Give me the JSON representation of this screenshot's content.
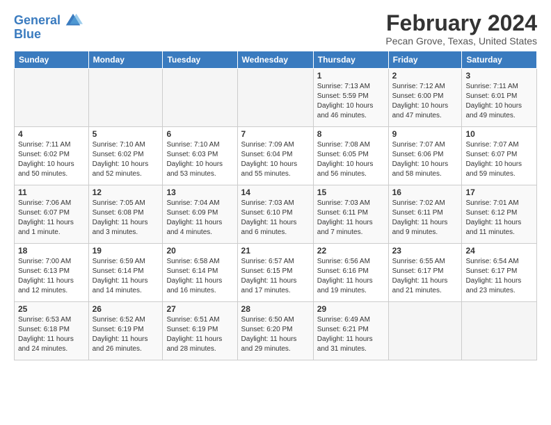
{
  "header": {
    "logo_line1": "General",
    "logo_line2": "Blue",
    "title": "February 2024",
    "subtitle": "Pecan Grove, Texas, United States"
  },
  "days_of_week": [
    "Sunday",
    "Monday",
    "Tuesday",
    "Wednesday",
    "Thursday",
    "Friday",
    "Saturday"
  ],
  "weeks": [
    [
      {
        "day": "",
        "info": ""
      },
      {
        "day": "",
        "info": ""
      },
      {
        "day": "",
        "info": ""
      },
      {
        "day": "",
        "info": ""
      },
      {
        "day": "1",
        "info": "Sunrise: 7:13 AM\nSunset: 5:59 PM\nDaylight: 10 hours\nand 46 minutes."
      },
      {
        "day": "2",
        "info": "Sunrise: 7:12 AM\nSunset: 6:00 PM\nDaylight: 10 hours\nand 47 minutes."
      },
      {
        "day": "3",
        "info": "Sunrise: 7:11 AM\nSunset: 6:01 PM\nDaylight: 10 hours\nand 49 minutes."
      }
    ],
    [
      {
        "day": "4",
        "info": "Sunrise: 7:11 AM\nSunset: 6:02 PM\nDaylight: 10 hours\nand 50 minutes."
      },
      {
        "day": "5",
        "info": "Sunrise: 7:10 AM\nSunset: 6:02 PM\nDaylight: 10 hours\nand 52 minutes."
      },
      {
        "day": "6",
        "info": "Sunrise: 7:10 AM\nSunset: 6:03 PM\nDaylight: 10 hours\nand 53 minutes."
      },
      {
        "day": "7",
        "info": "Sunrise: 7:09 AM\nSunset: 6:04 PM\nDaylight: 10 hours\nand 55 minutes."
      },
      {
        "day": "8",
        "info": "Sunrise: 7:08 AM\nSunset: 6:05 PM\nDaylight: 10 hours\nand 56 minutes."
      },
      {
        "day": "9",
        "info": "Sunrise: 7:07 AM\nSunset: 6:06 PM\nDaylight: 10 hours\nand 58 minutes."
      },
      {
        "day": "10",
        "info": "Sunrise: 7:07 AM\nSunset: 6:07 PM\nDaylight: 10 hours\nand 59 minutes."
      }
    ],
    [
      {
        "day": "11",
        "info": "Sunrise: 7:06 AM\nSunset: 6:07 PM\nDaylight: 11 hours\nand 1 minute."
      },
      {
        "day": "12",
        "info": "Sunrise: 7:05 AM\nSunset: 6:08 PM\nDaylight: 11 hours\nand 3 minutes."
      },
      {
        "day": "13",
        "info": "Sunrise: 7:04 AM\nSunset: 6:09 PM\nDaylight: 11 hours\nand 4 minutes."
      },
      {
        "day": "14",
        "info": "Sunrise: 7:03 AM\nSunset: 6:10 PM\nDaylight: 11 hours\nand 6 minutes."
      },
      {
        "day": "15",
        "info": "Sunrise: 7:03 AM\nSunset: 6:11 PM\nDaylight: 11 hours\nand 7 minutes."
      },
      {
        "day": "16",
        "info": "Sunrise: 7:02 AM\nSunset: 6:11 PM\nDaylight: 11 hours\nand 9 minutes."
      },
      {
        "day": "17",
        "info": "Sunrise: 7:01 AM\nSunset: 6:12 PM\nDaylight: 11 hours\nand 11 minutes."
      }
    ],
    [
      {
        "day": "18",
        "info": "Sunrise: 7:00 AM\nSunset: 6:13 PM\nDaylight: 11 hours\nand 12 minutes."
      },
      {
        "day": "19",
        "info": "Sunrise: 6:59 AM\nSunset: 6:14 PM\nDaylight: 11 hours\nand 14 minutes."
      },
      {
        "day": "20",
        "info": "Sunrise: 6:58 AM\nSunset: 6:14 PM\nDaylight: 11 hours\nand 16 minutes."
      },
      {
        "day": "21",
        "info": "Sunrise: 6:57 AM\nSunset: 6:15 PM\nDaylight: 11 hours\nand 17 minutes."
      },
      {
        "day": "22",
        "info": "Sunrise: 6:56 AM\nSunset: 6:16 PM\nDaylight: 11 hours\nand 19 minutes."
      },
      {
        "day": "23",
        "info": "Sunrise: 6:55 AM\nSunset: 6:17 PM\nDaylight: 11 hours\nand 21 minutes."
      },
      {
        "day": "24",
        "info": "Sunrise: 6:54 AM\nSunset: 6:17 PM\nDaylight: 11 hours\nand 23 minutes."
      }
    ],
    [
      {
        "day": "25",
        "info": "Sunrise: 6:53 AM\nSunset: 6:18 PM\nDaylight: 11 hours\nand 24 minutes."
      },
      {
        "day": "26",
        "info": "Sunrise: 6:52 AM\nSunset: 6:19 PM\nDaylight: 11 hours\nand 26 minutes."
      },
      {
        "day": "27",
        "info": "Sunrise: 6:51 AM\nSunset: 6:19 PM\nDaylight: 11 hours\nand 28 minutes."
      },
      {
        "day": "28",
        "info": "Sunrise: 6:50 AM\nSunset: 6:20 PM\nDaylight: 11 hours\nand 29 minutes."
      },
      {
        "day": "29",
        "info": "Sunrise: 6:49 AM\nSunset: 6:21 PM\nDaylight: 11 hours\nand 31 minutes."
      },
      {
        "day": "",
        "info": ""
      },
      {
        "day": "",
        "info": ""
      }
    ]
  ]
}
